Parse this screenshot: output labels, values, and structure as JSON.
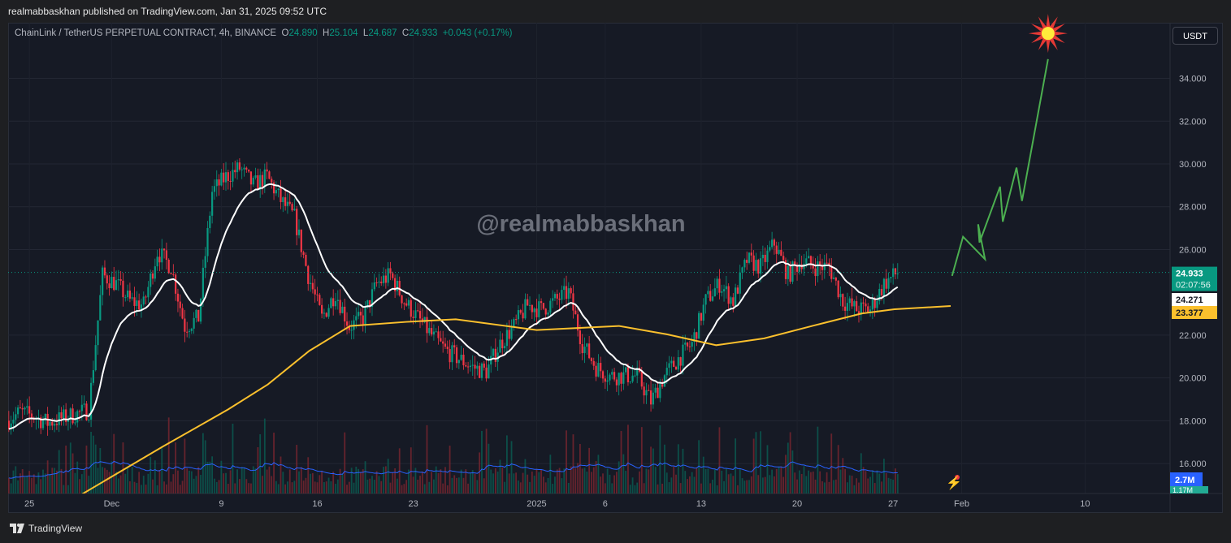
{
  "header": {
    "published": "realmabbaskhan published on TradingView.com, Jan 31, 2025 09:52 UTC"
  },
  "legend": {
    "symbol": "ChainLink / TetherUS PERPETUAL CONTRACT, 4h, BINANCE",
    "o_label": "O",
    "o": "24.890",
    "h_label": "H",
    "h": "25.104",
    "l_label": "L",
    "l": "24.687",
    "c_label": "C",
    "c": "24.933",
    "change": "+0.043 (+0.17%)"
  },
  "currency_button": "USDT",
  "watermark": "@realmabbaskhan",
  "footer": {
    "brand": "TradingView"
  },
  "colors": {
    "up": "#089981",
    "down": "#f23645",
    "ma_fast": "#ffffff",
    "ma_slow": "#fbc02d",
    "projection": "#4caf50",
    "volume_ma": "#2962ff"
  },
  "chart_data": {
    "type": "candlestick",
    "timeframe": "4h",
    "x_unit": "days since Nov 25",
    "y_ticks": [
      "34.000",
      "32.000",
      "30.000",
      "28.000",
      "26.000",
      "22.000",
      "20.000",
      "18.000",
      "16.000"
    ],
    "y_tick_values": [
      34,
      32,
      30,
      28,
      26,
      22,
      20,
      18,
      16
    ],
    "ylim": [
      14.6,
      36.6
    ],
    "xlim": [
      -1.55,
      83.2
    ],
    "x_ticks": [
      {
        "label": "25",
        "day": 0
      },
      {
        "label": "Dec",
        "day": 6
      },
      {
        "label": "9",
        "day": 14
      },
      {
        "label": "16",
        "day": 21
      },
      {
        "label": "23",
        "day": 28
      },
      {
        "label": "2025",
        "day": 37
      },
      {
        "label": "6",
        "day": 42
      },
      {
        "label": "13",
        "day": 49
      },
      {
        "label": "20",
        "day": 56
      },
      {
        "label": "27",
        "day": 63
      },
      {
        "label": "Feb",
        "day": 68
      },
      {
        "label": "10",
        "day": 77
      }
    ],
    "daily_closes": [
      18.0,
      18.4,
      18.2,
      17.9,
      18.1,
      18.3,
      18.5,
      24.8,
      24.4,
      23.6,
      23.4,
      25.9,
      25.2,
      22.4,
      22.8,
      28.7,
      29.4,
      29.8,
      29.0,
      29.4,
      28.3,
      27.5,
      24.8,
      22.8,
      24.0,
      22.4,
      22.8,
      24.4,
      24.8,
      23.6,
      22.8,
      22.0,
      21.3,
      20.9,
      20.5,
      20.3,
      21.6,
      22.4,
      23.4,
      23.2,
      23.6,
      24.0,
      21.6,
      20.5,
      20.1,
      20.1,
      20.1,
      18.9,
      20.1,
      20.9,
      21.6,
      23.6,
      24.4,
      23.6,
      25.5,
      25.2,
      26.3,
      24.8,
      25.5,
      25.2,
      25.2,
      23.6,
      23.2,
      23.2,
      24.4,
      24.93
    ],
    "ma_slow_points": [
      [
        3.5,
        14.44
      ],
      [
        9.7,
        16.78
      ],
      [
        14.5,
        18.53
      ],
      [
        17.4,
        19.7
      ],
      [
        20.4,
        21.26
      ],
      [
        23.4,
        22.43
      ],
      [
        27.5,
        22.62
      ],
      [
        31.1,
        22.74
      ],
      [
        37,
        22.24
      ],
      [
        43,
        22.43
      ],
      [
        46.5,
        22.04
      ],
      [
        50.1,
        21.53
      ],
      [
        53.6,
        21.85
      ],
      [
        57.1,
        22.43
      ],
      [
        60.7,
        23.01
      ],
      [
        63.1,
        23.21
      ],
      [
        67.2,
        23.36
      ]
    ],
    "projection_points": [
      [
        67.3,
        24.77
      ],
      [
        68.1,
        26.6
      ],
      [
        69.7,
        25.55
      ],
      [
        69.2,
        27.18
      ],
      [
        69.3,
        26.33
      ],
      [
        70.8,
        28.94
      ],
      [
        71.0,
        27.3
      ],
      [
        72.0,
        29.83
      ],
      [
        72.4,
        28.27
      ],
      [
        74.3,
        34.9
      ]
    ],
    "price_labels": [
      {
        "text": "24.933",
        "sub": "02:07:56",
        "value": 24.933,
        "color": "#089981"
      },
      {
        "text": "24.271",
        "value": 24.271,
        "color": "#ffffff"
      },
      {
        "text": "23.377",
        "value": 23.377,
        "color": "#fbc02d"
      }
    ],
    "volume_label": "2.7M",
    "volume_label2": "1.17M"
  }
}
